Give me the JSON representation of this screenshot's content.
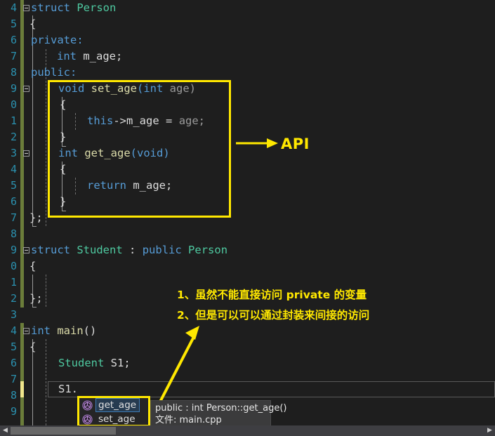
{
  "editor": {
    "language": "cpp",
    "filename": "main.cpp",
    "background": "#1e1e1e",
    "line_number_color": "#2b91af",
    "first_visible_line": 4,
    "last_visible_line": 29,
    "line_numbers": [
      "4",
      "5",
      "6",
      "7",
      "8",
      "9",
      "0",
      "1",
      "2",
      "3",
      "4",
      "5",
      "6",
      "7",
      "8",
      "9",
      "0",
      "1",
      "2",
      "3",
      "4",
      "5",
      "6",
      "7",
      "8",
      "9"
    ],
    "code_lines": [
      {
        "n": "4",
        "text": "struct Person"
      },
      {
        "n": "5",
        "text": "{"
      },
      {
        "n": "6",
        "text": "private:"
      },
      {
        "n": "7",
        "text": "    int m_age;"
      },
      {
        "n": "8",
        "text": "public:"
      },
      {
        "n": "9",
        "text": "    void set_age(int age)"
      },
      {
        "n": "0",
        "text": "    {"
      },
      {
        "n": "1",
        "text": "        this->m_age = age;"
      },
      {
        "n": "2",
        "text": "    }"
      },
      {
        "n": "3",
        "text": "    int get_age(void)"
      },
      {
        "n": "4",
        "text": "    {"
      },
      {
        "n": "5",
        "text": "        return m_age;"
      },
      {
        "n": "6",
        "text": "    }"
      },
      {
        "n": "7",
        "text": "};"
      },
      {
        "n": "8",
        "text": ""
      },
      {
        "n": "9",
        "text": "struct Student : public Person"
      },
      {
        "n": "0",
        "text": "{"
      },
      {
        "n": "1",
        "text": ""
      },
      {
        "n": "2",
        "text": "};"
      },
      {
        "n": "3",
        "text": ""
      },
      {
        "n": "4",
        "text": "int main()"
      },
      {
        "n": "5",
        "text": "{"
      },
      {
        "n": "6",
        "text": "    Student S1;"
      },
      {
        "n": "7",
        "text": "    S1."
      },
      {
        "n": "8",
        "text": ""
      },
      {
        "n": "9",
        "text": ""
      }
    ],
    "tokens": {
      "t_struct": "struct",
      "t_person": "Person",
      "t_open_brace": "{",
      "t_private": "private:",
      "t_int": "int",
      "t_m_age_decl": "m_age;",
      "t_public": "public:",
      "t_void": "void",
      "t_set_age": "set_age",
      "t_paren_int": "(int",
      "t_age_param": "age)",
      "t_this": "this",
      "t_arrow_m_age": "->m_age",
      "t_eq": "=",
      "t_age_semi": "age;",
      "t_close_brace": "}",
      "t_get_age": "get_age",
      "t_paren_void": "(void)",
      "t_return": "return",
      "t_m_age_semi": "m_age;",
      "t_end_struct": "};",
      "t_student": "Student",
      "t_colon": ":",
      "t_public_kw": "public",
      "t_main_int": "int",
      "t_main": "main",
      "t_main_parens": "()",
      "t_student_type": "Student",
      "t_s1_decl": "S1;",
      "t_s1_dot": "S1."
    },
    "colors": {
      "keyword": "#569cd6",
      "type": "#4ec9a0",
      "function": "#dcdcaa",
      "variable": "#dcdcdc",
      "parameter": "#9b9b9b",
      "annotation_yellow": "#ffe800",
      "change_saved": "#6b7d3a",
      "change_unsaved": "#f0e68c"
    }
  },
  "annotations": {
    "api_label": "API",
    "note_line1": "1、虽然不能直接访问 private 的变量",
    "note_line2": "2、但是可以可以通过封装来间接的访问"
  },
  "intellisense": {
    "items": [
      {
        "label": "get_age",
        "icon": "method-icon",
        "selected": true
      },
      {
        "label": "set_age",
        "icon": "method-icon",
        "selected": false
      }
    ],
    "ghost_item_label": "[=]",
    "tooltip": {
      "signature": "public : int Person::get_age()",
      "file_line": "文件: main.cpp"
    }
  },
  "scrollbar": {
    "left_arrow": "◀",
    "right_arrow": "▶"
  }
}
